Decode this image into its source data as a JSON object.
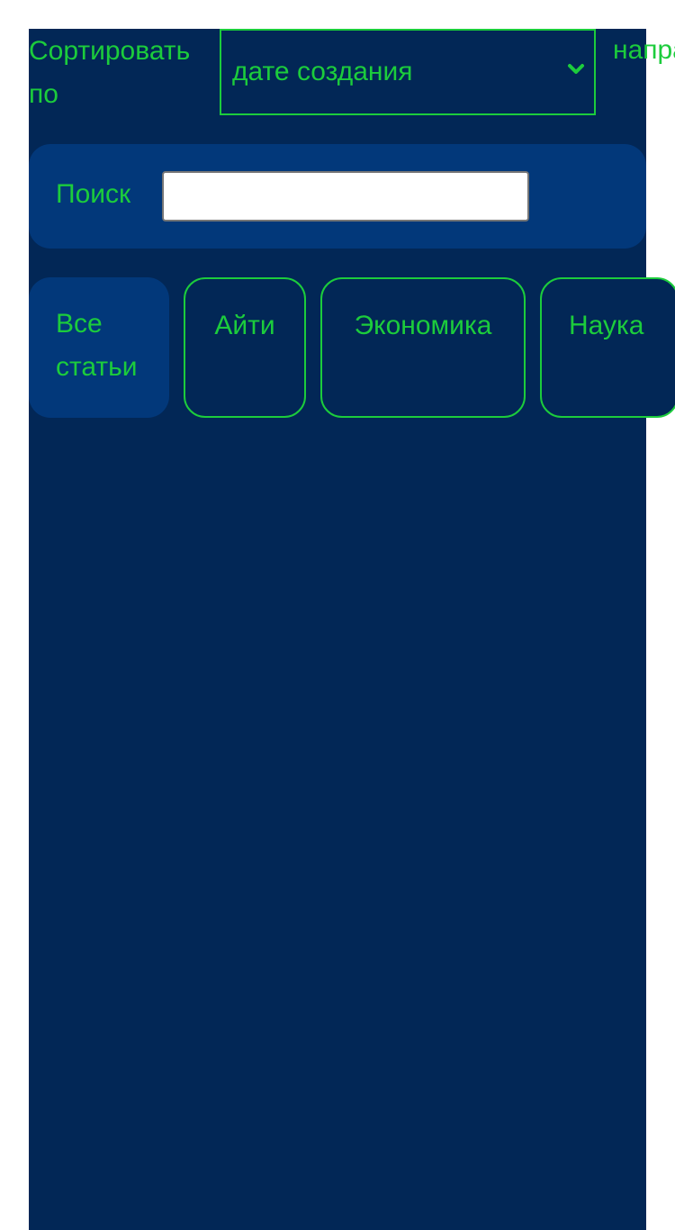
{
  "sort": {
    "label": "Сортировать по",
    "selected": "дате создания",
    "direction_label": "направление"
  },
  "search": {
    "label": "Поиск",
    "value": ""
  },
  "tabs": [
    {
      "label": "Все статьи",
      "active": true
    },
    {
      "label": "Айти",
      "active": false
    },
    {
      "label": "Экономика",
      "active": false
    },
    {
      "label": "Наука",
      "active": false
    }
  ],
  "colors": {
    "background": "#022756",
    "panel": "#02387a",
    "accent": "#1ccc3c"
  }
}
